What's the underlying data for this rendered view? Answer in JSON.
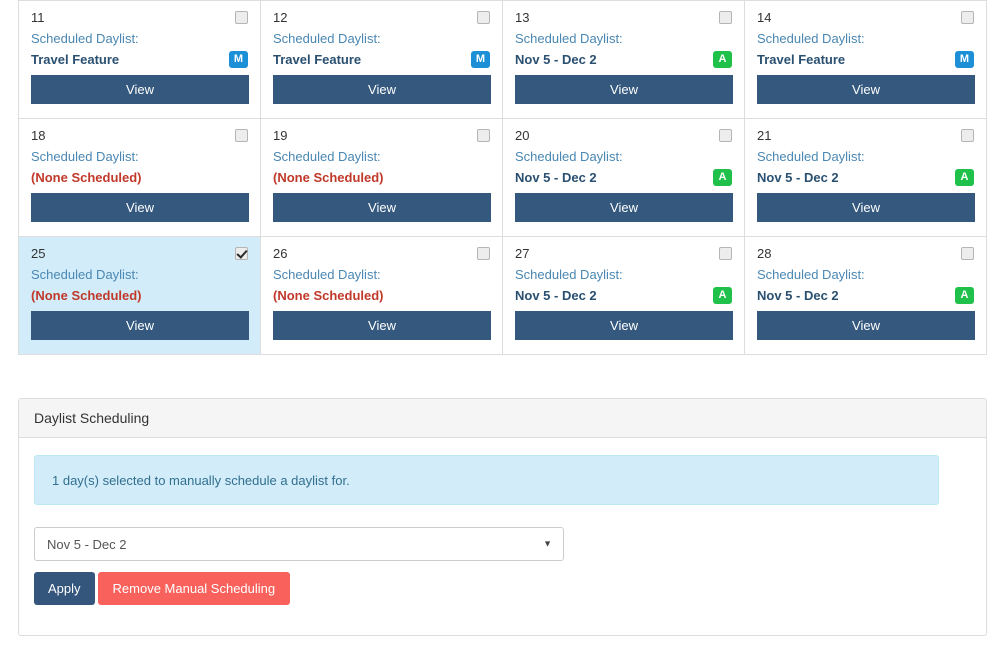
{
  "calendar": {
    "scheduled_label": "Scheduled Daylist:",
    "view_label": "View",
    "none_text": "(None Scheduled)",
    "badge_manual": "M",
    "badge_auto": "A",
    "rows": [
      [
        {
          "day": "11",
          "value": "Travel Feature",
          "none": false,
          "badge": "M",
          "badge_type": "m",
          "selected": false,
          "checked": false
        },
        {
          "day": "12",
          "value": "Travel Feature",
          "none": false,
          "badge": "M",
          "badge_type": "m",
          "selected": false,
          "checked": false
        },
        {
          "day": "13",
          "value": "Nov 5 - Dec 2",
          "none": false,
          "badge": "A",
          "badge_type": "a",
          "selected": false,
          "checked": false
        },
        {
          "day": "14",
          "value": "Travel Feature",
          "none": false,
          "badge": "M",
          "badge_type": "m",
          "selected": false,
          "checked": false
        }
      ],
      [
        {
          "day": "18",
          "value": "(None Scheduled)",
          "none": true,
          "badge": "",
          "badge_type": "",
          "selected": false,
          "checked": false
        },
        {
          "day": "19",
          "value": "(None Scheduled)",
          "none": true,
          "badge": "",
          "badge_type": "",
          "selected": false,
          "checked": false
        },
        {
          "day": "20",
          "value": "Nov 5 - Dec 2",
          "none": false,
          "badge": "A",
          "badge_type": "a",
          "selected": false,
          "checked": false
        },
        {
          "day": "21",
          "value": "Nov 5 - Dec 2",
          "none": false,
          "badge": "A",
          "badge_type": "a",
          "selected": false,
          "checked": false
        }
      ],
      [
        {
          "day": "25",
          "value": "(None Scheduled)",
          "none": true,
          "badge": "",
          "badge_type": "",
          "selected": true,
          "checked": true
        },
        {
          "day": "26",
          "value": "(None Scheduled)",
          "none": true,
          "badge": "",
          "badge_type": "",
          "selected": false,
          "checked": false
        },
        {
          "day": "27",
          "value": "Nov 5 - Dec 2",
          "none": false,
          "badge": "A",
          "badge_type": "a",
          "selected": false,
          "checked": false
        },
        {
          "day": "28",
          "value": "Nov 5 - Dec 2",
          "none": false,
          "badge": "A",
          "badge_type": "a",
          "selected": false,
          "checked": false
        }
      ]
    ]
  },
  "panel": {
    "title": "Daylist Scheduling",
    "alert_text": "1 day(s) selected to manually schedule a daylist for.",
    "select_value": "Nov 5 - Dec 2",
    "select_arrow": "▼",
    "apply_label": "Apply",
    "remove_label": "Remove Manual Scheduling"
  },
  "colors": {
    "primary": "#34587e",
    "danger": "#f9615c",
    "badge_manual": "#1c8fd6",
    "badge_auto": "#1fc14a",
    "info_bg": "#d2ecf9",
    "link": "#4a87b3",
    "none_text": "#c0392b"
  }
}
